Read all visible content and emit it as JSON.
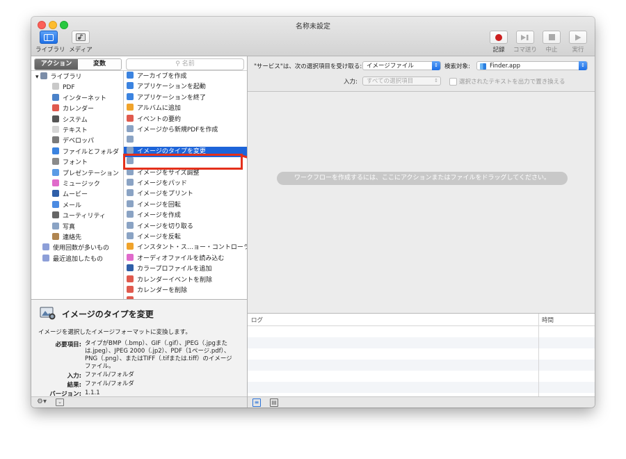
{
  "window": {
    "title": "名称未設定"
  },
  "toolbar": {
    "library_label": "ライブラリ",
    "media_label": "メディア",
    "record_label": "記録",
    "step_label": "コマ送り",
    "stop_label": "中止",
    "run_label": "実行"
  },
  "library": {
    "tabs": [
      "アクション",
      "変数"
    ],
    "search_placeholder": "名前",
    "categories": [
      {
        "label": "ライブラリ",
        "icon": "library-icon",
        "color": "#7b8da8"
      },
      {
        "label": "PDF",
        "icon": "pdf-icon",
        "color": "#c9c9c9"
      },
      {
        "label": "インターネット",
        "icon": "globe-icon",
        "color": "#4a82c9"
      },
      {
        "label": "カレンダー",
        "icon": "calendar-icon",
        "color": "#e05a4e"
      },
      {
        "label": "システム",
        "icon": "system-icon",
        "color": "#555555"
      },
      {
        "label": "テキスト",
        "icon": "text-icon",
        "color": "#d6d6d6"
      },
      {
        "label": "デベロッパ",
        "icon": "developer-icon",
        "color": "#7a7a7a"
      },
      {
        "label": "ファイルとフォルダ",
        "icon": "finder-icon",
        "color": "#3b83e0"
      },
      {
        "label": "フォント",
        "icon": "font-icon",
        "color": "#8a8a8a"
      },
      {
        "label": "プレゼンテーション",
        "icon": "presentation-icon",
        "color": "#5b9be5"
      },
      {
        "label": "ミュージック",
        "icon": "music-icon",
        "color": "#e06acb"
      },
      {
        "label": "ムービー",
        "icon": "movie-icon",
        "color": "#2f5fa8"
      },
      {
        "label": "メール",
        "icon": "mail-icon",
        "color": "#4b8be2"
      },
      {
        "label": "ユーティリティ",
        "icon": "utility-icon",
        "color": "#666666"
      },
      {
        "label": "写真",
        "icon": "photo-icon",
        "color": "#8aa3c4"
      },
      {
        "label": "連絡先",
        "icon": "contacts-icon",
        "color": "#b08550"
      },
      {
        "label": "使用回数が多いもの",
        "icon": "smart-folder-icon",
        "color": "#8d9fd8"
      },
      {
        "label": "最近追加したもの",
        "icon": "smart-folder-icon",
        "color": "#8d9fd8"
      }
    ],
    "actions": [
      {
        "label": "アーカイブを作成",
        "icon": "finder-icon",
        "color": "#3b83e0"
      },
      {
        "label": "アプリケーションを起動",
        "icon": "finder-icon",
        "color": "#3b83e0"
      },
      {
        "label": "アプリケーションを終了",
        "icon": "finder-icon",
        "color": "#3b83e0"
      },
      {
        "label": "アルバムに追加",
        "icon": "photos-icon",
        "color": "#f0a32b"
      },
      {
        "label": "イベントの要約",
        "icon": "calendar-icon",
        "color": "#e05a4e"
      },
      {
        "label": "イメージから新規PDFを作成",
        "icon": "preview-icon",
        "color": "#8aa3c4"
      },
      {
        "label": "",
        "icon": "preview-icon",
        "color": "#8aa3c4"
      },
      {
        "label": "イメージのタイプを変更",
        "icon": "preview-icon",
        "color": "#8aa3c4",
        "selected": true
      },
      {
        "label": "",
        "icon": "preview-icon",
        "color": "#8aa3c4"
      },
      {
        "label": "イメージをサイズ調整",
        "icon": "preview-icon",
        "color": "#8aa3c4"
      },
      {
        "label": "イメージをパッド",
        "icon": "preview-icon",
        "color": "#8aa3c4"
      },
      {
        "label": "イメージをプリント",
        "icon": "preview-icon",
        "color": "#8aa3c4"
      },
      {
        "label": "イメージを回転",
        "icon": "preview-icon",
        "color": "#8aa3c4"
      },
      {
        "label": "イメージを作成",
        "icon": "preview-icon",
        "color": "#8aa3c4"
      },
      {
        "label": "イメージを切り取る",
        "icon": "preview-icon",
        "color": "#8aa3c4"
      },
      {
        "label": "イメージを反転",
        "icon": "preview-icon",
        "color": "#8aa3c4"
      },
      {
        "label": "インスタント・ス…ョー・コントローラ",
        "icon": "photos-icon",
        "color": "#f0a32b"
      },
      {
        "label": "オーディオファイルを読み込む",
        "icon": "music-icon",
        "color": "#e06acb"
      },
      {
        "label": "カラープロファイルを追加",
        "icon": "colorsync-icon",
        "color": "#2f5fa8"
      },
      {
        "label": "カレンダーイベントを削除",
        "icon": "calendar-icon",
        "color": "#e05a4e"
      },
      {
        "label": "カレンダーを削除",
        "icon": "calendar-icon",
        "color": "#e05a4e"
      },
      {
        "label": "",
        "icon": "calendar-icon",
        "color": "#e05a4e"
      }
    ]
  },
  "description": {
    "title": "イメージのタイプを変更",
    "summary": "イメージを選択したイメージフォーマットに変換します。",
    "requirements_key": "必要項目:",
    "requirements_value": "タイプがBMP（.bmp）、GIF（.gif）、JPEG（.jpgまたは.jpeg）、JPEG 2000（.jp2）、PDF（1ページ.pdf）、PNG（.png）、またはTIFF（.tifまたは.tiff）のイメージファイル。",
    "input_key": "入力:",
    "input_value": "ファイル/フォルダ",
    "result_key": "結果:",
    "result_value": "ファイル/フォルダ",
    "version_key": "バージョン:",
    "version_value": "1.1.1"
  },
  "workflow": {
    "receives_label": "\"サービス\"は、次の選択項目を受け取る:",
    "receives_value": "イメージファイル",
    "target_label": "検索対象:",
    "target_value": "Finder.app",
    "input_label": "入力:",
    "input_value": "すべての選択項目",
    "replace_label": "選択されたテキストを出力で置き換える",
    "hint": "ワークフローを作成するには、ここにアクションまたはファイルをドラッグしてください。"
  },
  "log": {
    "log_header": "ログ",
    "time_header": "時間"
  },
  "colors": {
    "selection": "#1d64d9",
    "annotation": "#e4301b",
    "record": "#cc1f1f"
  }
}
